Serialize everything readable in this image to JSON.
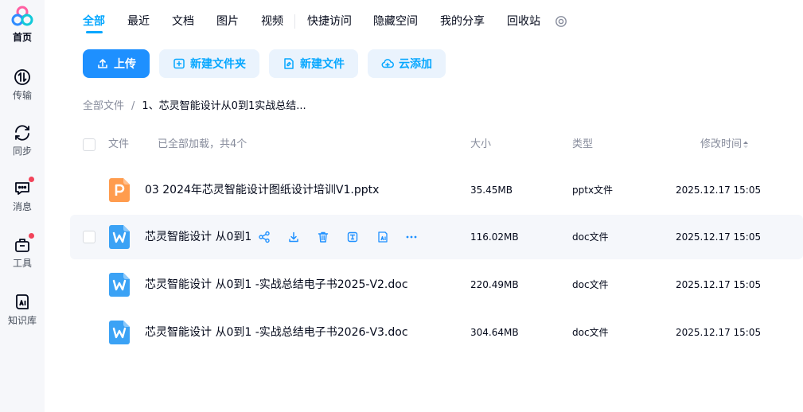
{
  "colors": {
    "accent": "#06a7ff",
    "primary_button": "#1e90ff",
    "secondary_button_bg": "#eaf3fd",
    "badge": "#f2445a",
    "ppt_icon": "#ff9c4e",
    "doc_icon": "#3ba2f5"
  },
  "sidebar": {
    "items": [
      {
        "label": "首页",
        "icon": "logo-icon"
      },
      {
        "label": "传输",
        "icon": "transfer-icon"
      },
      {
        "label": "同步",
        "icon": "sync-icon"
      },
      {
        "label": "消息",
        "icon": "message-icon"
      },
      {
        "label": "工具",
        "icon": "toolbox-icon"
      },
      {
        "label": "知识库",
        "icon": "knowledge-ai-icon"
      }
    ]
  },
  "tabs": [
    "全部",
    "最近",
    "文档",
    "图片",
    "视频",
    "快捷访问",
    "隐藏空间",
    "我的分享",
    "回收站"
  ],
  "toolbar": {
    "upload": "上传",
    "new_folder": "新建文件夹",
    "new_file": "新建文件",
    "cloud_add": "云添加"
  },
  "breadcrumb": {
    "root": "全部文件",
    "separator": "/",
    "current": "1、芯灵智能设计从0到1实战总结..."
  },
  "table": {
    "headers": {
      "file": "文件",
      "load_status": "已全部加载，共4个",
      "size": "大小",
      "type": "类型",
      "modified": "修改时间"
    },
    "rows": [
      {
        "name": "03 2024年芯灵智能设计图纸设计培训V1.pptx",
        "size": "35.45MB",
        "type": "pptx文件",
        "modified": "2025.12.17 15:05",
        "icon": "ppt-file-icon"
      },
      {
        "name": "芯灵智能设计 从0到1",
        "size": "116.02MB",
        "type": "doc文件",
        "modified": "2025.12.17 15:05",
        "icon": "word-file-icon"
      },
      {
        "name": "芯灵智能设计 从0到1 -实战总结电子书2025-V2.doc",
        "size": "220.49MB",
        "type": "doc文件",
        "modified": "2025.12.17 15:05",
        "icon": "word-file-icon"
      },
      {
        "name": "芯灵智能设计 从0到1 -实战总结电子书2026-V3.doc",
        "size": "304.64MB",
        "type": "doc文件",
        "modified": "2025.12.17 15:05",
        "icon": "word-file-icon"
      }
    ]
  },
  "row_actions": [
    "share-icon",
    "download-icon",
    "delete-icon",
    "open-text-icon",
    "ai-read-icon",
    "more-icon"
  ]
}
